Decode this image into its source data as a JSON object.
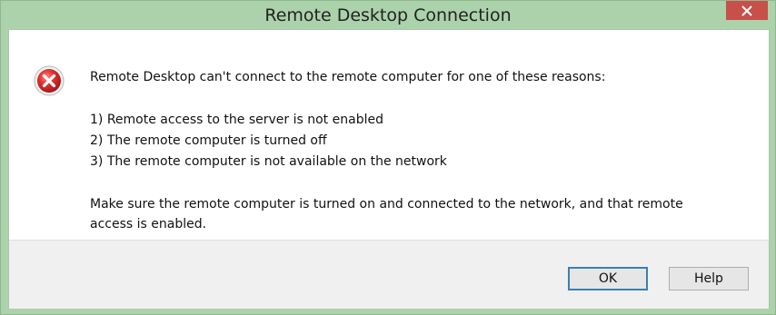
{
  "window": {
    "title": "Remote Desktop Connection"
  },
  "message": {
    "icon": "error-icon",
    "heading": "Remote Desktop can't connect to the remote computer for one of these reasons:",
    "reasons": [
      "1) Remote access to the server is not enabled",
      "2) The remote computer is turned off",
      "3) The remote computer is not available on the network"
    ],
    "advice_line1": "Make sure the remote computer is turned on and connected to the network, and that remote",
    "advice_line2": "access is enabled."
  },
  "buttons": {
    "ok": "OK",
    "help": "Help"
  },
  "colors": {
    "titlebar": "#abd2ab",
    "close_button": "#c7504a",
    "error_red": "#c8252b",
    "default_button_border": "#3c7fb1"
  }
}
